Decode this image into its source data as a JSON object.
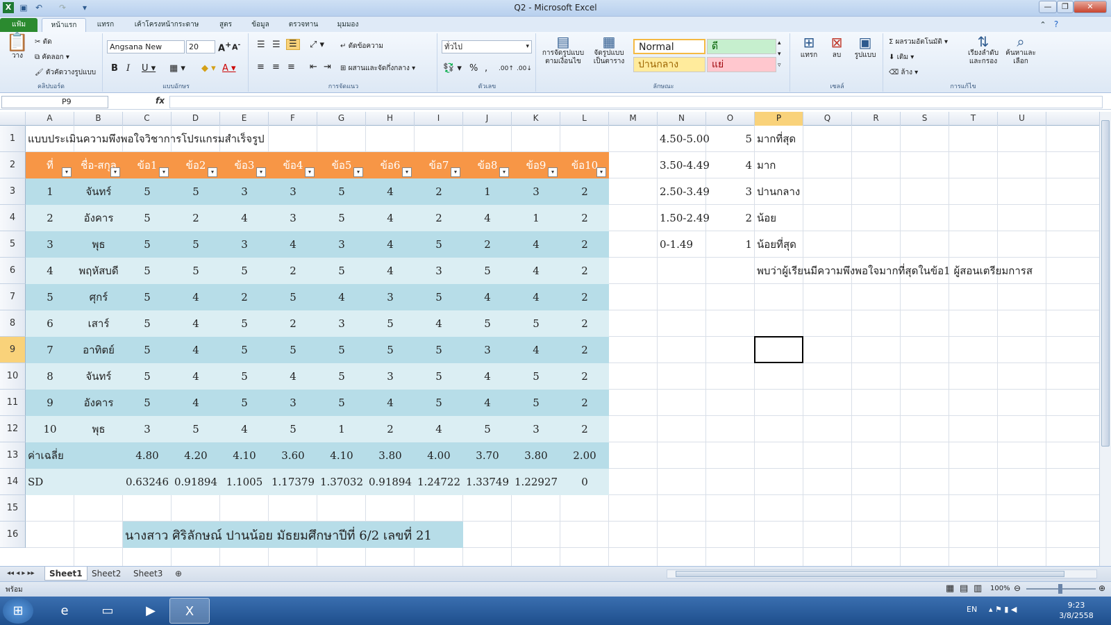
{
  "window": {
    "title": "Q2 - Microsoft Excel",
    "app_icon": "excel-icon"
  },
  "ribbon_tabs": [
    "แฟ้ม",
    "หน้าแรก",
    "แทรก",
    "เค้าโครงหน้ากระดาษ",
    "สูตร",
    "ข้อมูล",
    "ตรวจทาน",
    "มุมมอง"
  ],
  "ribbon": {
    "clipboard": {
      "paste": "วาง",
      "cut": "ตัด",
      "copy": "คัดลอก",
      "format_painter": "ตัวคัดวางรูปแบบ",
      "label": "คลิปบอร์ด"
    },
    "font": {
      "name": "Angsana New",
      "size": "20",
      "label": "แบบอักษร"
    },
    "alignment": {
      "wrap": "ตัดข้อความ",
      "merge": "ผสานและจัดกึ่งกลาง",
      "label": "การจัดแนว"
    },
    "number": {
      "format": "ทั่วไป",
      "label": "ตัวเลข"
    },
    "styles": {
      "cond_format": "การจัดรูปแบบ ตามเงื่อนไข",
      "format_table": "จัดรูปแบบ เป็นตาราง",
      "normal": "Normal",
      "good": "ดี",
      "neutral": "ปานกลาง",
      "bad": "แย่",
      "label": "ลักษณะ"
    },
    "cells": {
      "insert": "แทรก",
      "delete": "ลบ",
      "format": "รูปแบบ",
      "label": "เซลล์"
    },
    "editing": {
      "autosum": "ผลรวมอัตโนมัติ",
      "fill": "เติม",
      "clear": "ล้าง",
      "sort": "เรียงลำดับ และกรอง",
      "find": "ค้นหาและ เลือก",
      "label": "การแก้ไข"
    }
  },
  "formula_bar": {
    "name_box": "P9",
    "fx": "fx",
    "content": ""
  },
  "columns": [
    "A",
    "B",
    "C",
    "D",
    "E",
    "F",
    "G",
    "H",
    "I",
    "J",
    "K",
    "L",
    "M",
    "N",
    "O",
    "P",
    "Q",
    "R",
    "S",
    "T",
    "U"
  ],
  "rows": [
    "1",
    "2",
    "3",
    "4",
    "5",
    "6",
    "7",
    "8",
    "9",
    "10",
    "11",
    "12",
    "13",
    "14",
    "15",
    "16"
  ],
  "sheet": {
    "title": "แบบประเมินความพึงพอใจวิชาการโปรแกรมสำเร็จรูป",
    "headers": [
      "ที่",
      "ชื่อ-สกุล",
      "ข้อ1",
      "ข้อ2",
      "ข้อ3",
      "ข้อ4",
      "ข้อ5",
      "ข้อ6",
      "ข้อ7",
      "ข้อ8",
      "ข้อ9",
      "ข้อ10"
    ],
    "data": [
      [
        "1",
        "จันทร์",
        "5",
        "5",
        "3",
        "3",
        "5",
        "4",
        "2",
        "1",
        "3",
        "2"
      ],
      [
        "2",
        "อังคาร",
        "5",
        "2",
        "4",
        "3",
        "5",
        "4",
        "2",
        "4",
        "1",
        "2"
      ],
      [
        "3",
        "พุธ",
        "5",
        "5",
        "3",
        "4",
        "3",
        "4",
        "5",
        "2",
        "4",
        "2"
      ],
      [
        "4",
        "พฤหัสบดี",
        "5",
        "5",
        "5",
        "2",
        "5",
        "4",
        "3",
        "5",
        "4",
        "2"
      ],
      [
        "5",
        "ศุกร์",
        "5",
        "4",
        "2",
        "5",
        "4",
        "3",
        "5",
        "4",
        "4",
        "2"
      ],
      [
        "6",
        "เสาร์",
        "5",
        "4",
        "5",
        "2",
        "3",
        "5",
        "4",
        "5",
        "5",
        "2"
      ],
      [
        "7",
        "อาทิตย์",
        "5",
        "4",
        "5",
        "5",
        "5",
        "5",
        "5",
        "3",
        "4",
        "2"
      ],
      [
        "8",
        "จันทร์",
        "5",
        "4",
        "5",
        "4",
        "5",
        "3",
        "5",
        "4",
        "5",
        "2"
      ],
      [
        "9",
        "อังคาร",
        "5",
        "4",
        "5",
        "3",
        "5",
        "4",
        "5",
        "4",
        "5",
        "2"
      ],
      [
        "10",
        "พุธ",
        "3",
        "5",
        "4",
        "5",
        "1",
        "2",
        "4",
        "5",
        "3",
        "2"
      ]
    ],
    "average_label": "ค่าเฉลี่ย",
    "averages": [
      "4.80",
      "4.20",
      "4.10",
      "3.60",
      "4.10",
      "3.80",
      "4.00",
      "3.70",
      "3.80",
      "2.00"
    ],
    "sd_label": "SD",
    "sds": [
      "0.63246",
      "0.91894",
      "1.1005",
      "1.17379",
      "1.37032",
      "0.91894",
      "1.24722",
      "1.33749",
      "1.22927",
      "0"
    ],
    "scale": [
      {
        "range": "4.50-5.00",
        "score": "5",
        "meaning": "มากที่สุด"
      },
      {
        "range": "3.50-4.49",
        "score": "4",
        "meaning": "มาก"
      },
      {
        "range": "2.50-3.49",
        "score": "3",
        "meaning": "ปานกลาง"
      },
      {
        "range": "1.50-2.49",
        "score": "2",
        "meaning": "น้อย"
      },
      {
        "range": "0-1.49",
        "score": "1",
        "meaning": "น้อยที่สุด"
      }
    ],
    "conclusion": "พบว่าผู้เรียนมีความพึงพอใจมากที่สุดในข้อ1 ผู้สอนเตรียมการส",
    "author": "นางสาว ศิริลักษณ์ ปานน้อย มัธยมศึกษาปีที่ 6/2  เลขที่ 21"
  },
  "sheet_tabs": [
    "Sheet1",
    "Sheet2",
    "Sheet3"
  ],
  "status": {
    "ready": "พร้อม",
    "zoom": "100%"
  },
  "taskbar": {
    "lang": "EN",
    "time": "9:23",
    "date": "3/8/2558"
  },
  "colors": {
    "header_orange": "#f79646",
    "band_dark": "#b7dde8",
    "band_light": "#dbeef3",
    "excel_green": "#2b8a2f"
  }
}
